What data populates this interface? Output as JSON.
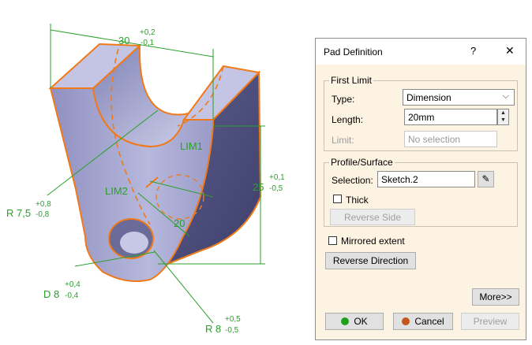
{
  "dialog": {
    "title": "Pad Definition",
    "help": "?",
    "close": "✕",
    "first_limit": {
      "legend": "First Limit",
      "type_label": "Type:",
      "type_value": "Dimension",
      "length_label": "Length:",
      "length_value": "20mm",
      "limit_label": "Limit:",
      "limit_value": "No selection"
    },
    "profile": {
      "legend": "Profile/Surface",
      "selection_label": "Selection:",
      "selection_value": "Sketch.2",
      "thick_label": "Thick",
      "reverse_side": "Reverse Side"
    },
    "mirrored_label": "Mirrored extent",
    "reverse_direction": "Reverse Direction",
    "more": "More>>",
    "ok": "OK",
    "cancel": "Cancel",
    "preview": "Preview"
  },
  "model": {
    "dims": {
      "width": "30",
      "width_tol_plus": "+0,2",
      "width_tol_minus": "-0,1",
      "height": "25",
      "height_tol_plus": "+0,1",
      "height_tol_minus": "-0,5",
      "radius": "R 7,5",
      "radius_tol_plus": "+0,8",
      "radius_tol_minus": "-0,8",
      "diameter": "D 8",
      "diameter_tol_plus": "+0,4",
      "diameter_tol_minus": "-0,4",
      "radius2": "R 8",
      "radius2_tol_plus": "+0,5",
      "radius2_tol_minus": "-0,5",
      "lim1": "LIM1",
      "lim2": "LIM2",
      "pad_len": "20"
    }
  }
}
